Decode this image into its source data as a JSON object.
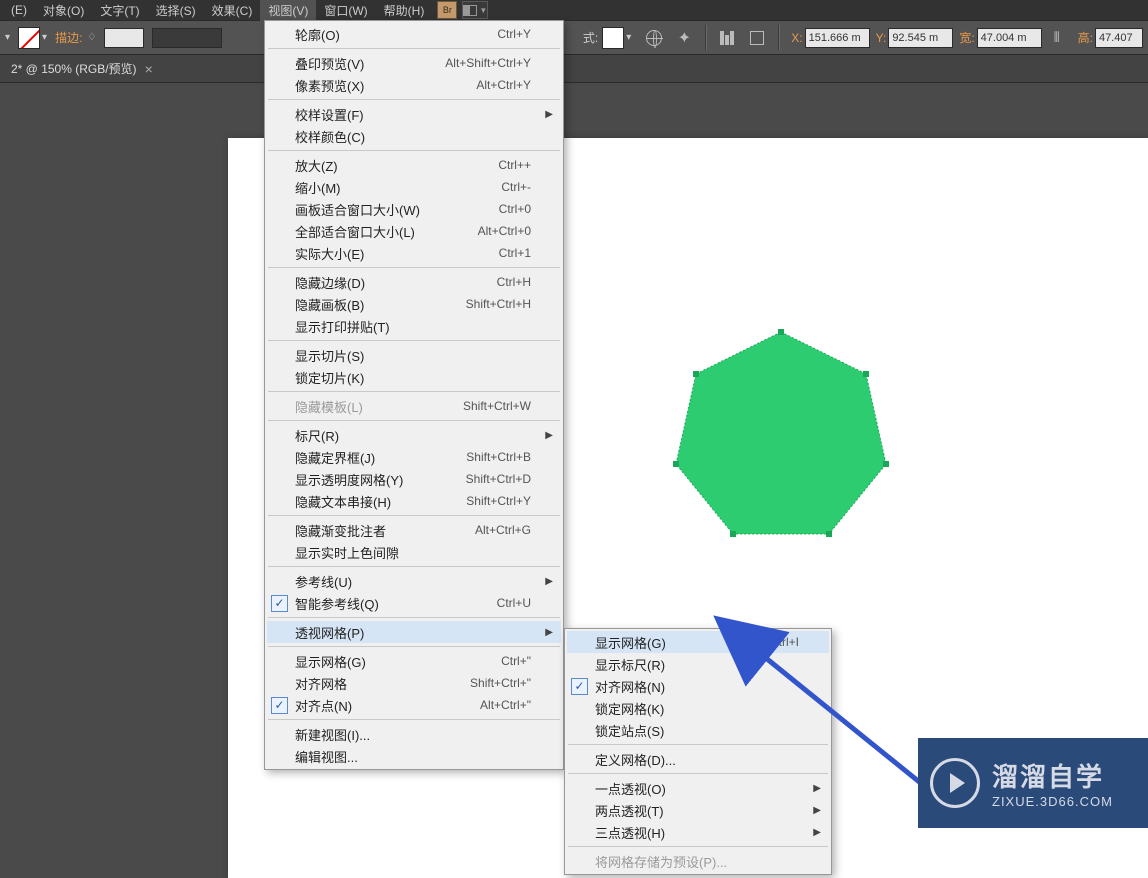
{
  "menubar": {
    "items": [
      "(E)",
      "对象(O)",
      "文字(T)",
      "选择(S)",
      "效果(C)",
      "视图(V)",
      "窗口(W)",
      "帮助(H)"
    ],
    "br": "Br"
  },
  "toolbar": {
    "stroke_label": "描边:",
    "style_label": "式:",
    "x_label": "X:",
    "x_value": "151.666 m",
    "y_label": "Y:",
    "y_value": "92.545 m",
    "w_label": "宽:",
    "w_value": "47.004 m",
    "h_label": "高:",
    "h_value": "47.407"
  },
  "tab": {
    "title": "2* @ 150% (RGB/预览)",
    "close": "×"
  },
  "view_menu": [
    {
      "lbl": "轮廓(O)",
      "sc": "Ctrl+Y"
    },
    {
      "sep": true
    },
    {
      "lbl": "叠印预览(V)",
      "sc": "Alt+Shift+Ctrl+Y"
    },
    {
      "lbl": "像素预览(X)",
      "sc": "Alt+Ctrl+Y"
    },
    {
      "sep": true
    },
    {
      "lbl": "校样设置(F)",
      "arr": true
    },
    {
      "lbl": "校样颜色(C)"
    },
    {
      "sep": true
    },
    {
      "lbl": "放大(Z)",
      "sc": "Ctrl++"
    },
    {
      "lbl": "缩小(M)",
      "sc": "Ctrl+-"
    },
    {
      "lbl": "画板适合窗口大小(W)",
      "sc": "Ctrl+0"
    },
    {
      "lbl": "全部适合窗口大小(L)",
      "sc": "Alt+Ctrl+0"
    },
    {
      "lbl": "实际大小(E)",
      "sc": "Ctrl+1"
    },
    {
      "sep": true
    },
    {
      "lbl": "隐藏边缘(D)",
      "sc": "Ctrl+H"
    },
    {
      "lbl": "隐藏画板(B)",
      "sc": "Shift+Ctrl+H"
    },
    {
      "lbl": "显示打印拼贴(T)"
    },
    {
      "sep": true
    },
    {
      "lbl": "显示切片(S)"
    },
    {
      "lbl": "锁定切片(K)"
    },
    {
      "sep": true
    },
    {
      "lbl": "隐藏模板(L)",
      "sc": "Shift+Ctrl+W",
      "disabled": true
    },
    {
      "sep": true
    },
    {
      "lbl": "标尺(R)",
      "arr": true
    },
    {
      "lbl": "隐藏定界框(J)",
      "sc": "Shift+Ctrl+B"
    },
    {
      "lbl": "显示透明度网格(Y)",
      "sc": "Shift+Ctrl+D"
    },
    {
      "lbl": "隐藏文本串接(H)",
      "sc": "Shift+Ctrl+Y"
    },
    {
      "sep": true
    },
    {
      "lbl": "隐藏渐变批注者",
      "sc": "Alt+Ctrl+G"
    },
    {
      "lbl": "显示实时上色间隙"
    },
    {
      "sep": true
    },
    {
      "lbl": "参考线(U)",
      "arr": true
    },
    {
      "lbl": "智能参考线(Q)",
      "sc": "Ctrl+U",
      "check": true
    },
    {
      "sep": true
    },
    {
      "lbl": "透视网格(P)",
      "arr": true,
      "highlight": true
    },
    {
      "sep": true
    },
    {
      "lbl": "显示网格(G)",
      "sc": "Ctrl+\""
    },
    {
      "lbl": "对齐网格",
      "sc": "Shift+Ctrl+\""
    },
    {
      "lbl": "对齐点(N)",
      "sc": "Alt+Ctrl+\"",
      "check": true
    },
    {
      "sep": true
    },
    {
      "lbl": "新建视图(I)..."
    },
    {
      "lbl": "编辑视图..."
    }
  ],
  "perspective_submenu": [
    {
      "lbl": "显示网格(G)",
      "sc": "Shift+Ctrl+I",
      "highlight": true
    },
    {
      "lbl": "显示标尺(R)"
    },
    {
      "lbl": "对齐网格(N)",
      "check": true
    },
    {
      "lbl": "锁定网格(K)"
    },
    {
      "lbl": "锁定站点(S)"
    },
    {
      "sep": true
    },
    {
      "lbl": "定义网格(D)..."
    },
    {
      "sep": true
    },
    {
      "lbl": "一点透视(O)",
      "arr": true
    },
    {
      "lbl": "两点透视(T)",
      "arr": true
    },
    {
      "lbl": "三点透视(H)",
      "arr": true
    },
    {
      "sep": true
    },
    {
      "lbl": "将网格存储为预设(P)...",
      "disabled": true
    }
  ],
  "watermark": {
    "big": "溜溜自学",
    "small": "ZIXUE.3D66.COM"
  }
}
